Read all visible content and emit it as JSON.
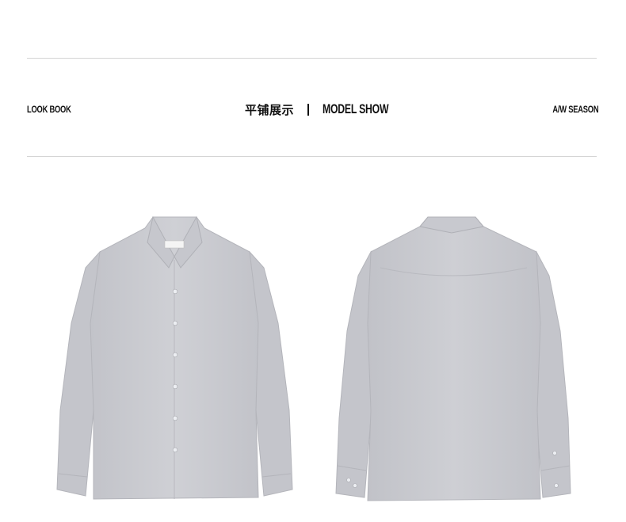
{
  "header": {
    "left_label": "LOOK BOOK",
    "title_cn": "平铺展示",
    "title_en": "MODEL SHOW",
    "right_label": "A/W SEASON"
  },
  "images": {
    "front": {
      "label": "",
      "color": "#c9cad0"
    },
    "back": {
      "label": "",
      "color": "#c9cad0"
    }
  },
  "colors": {
    "rule": "#d4d4d4",
    "text": "#111111",
    "shirt": "#c9cad0",
    "shirt_shadow": "#b4b5bb"
  }
}
